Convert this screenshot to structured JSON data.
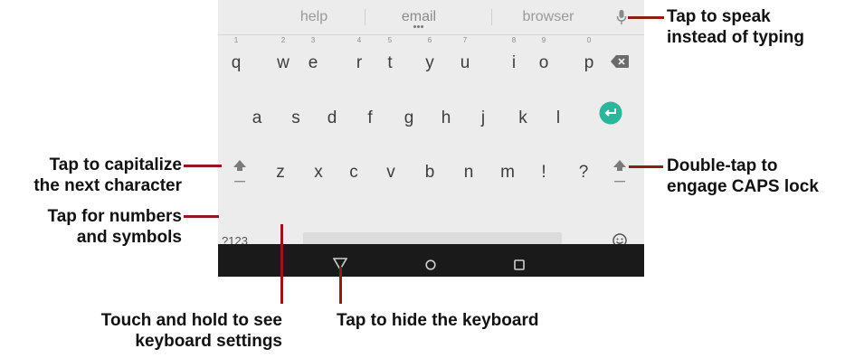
{
  "suggestions": {
    "left": "help",
    "center": "email",
    "right": "browser"
  },
  "icons": {
    "mic": "microphone-icon",
    "backspace": "backspace-icon",
    "enter": "enter-icon",
    "shift": "shift-arrow-icon",
    "emoji": "emoji-icon",
    "back": "nav-back-triangle-icon",
    "home": "nav-home-circle-icon",
    "recents": "nav-recents-square-icon"
  },
  "keys": {
    "row1": [
      {
        "letter": "q",
        "number": "1"
      },
      {
        "letter": "w",
        "number": "2"
      },
      {
        "letter": "e",
        "number": "3"
      },
      {
        "letter": "r",
        "number": "4"
      },
      {
        "letter": "t",
        "number": "5"
      },
      {
        "letter": "y",
        "number": "6"
      },
      {
        "letter": "u",
        "number": "7"
      },
      {
        "letter": "i",
        "number": "8"
      },
      {
        "letter": "o",
        "number": "9"
      },
      {
        "letter": "p",
        "number": "0"
      }
    ],
    "row2": [
      "a",
      "s",
      "d",
      "f",
      "g",
      "h",
      "j",
      "k",
      "l"
    ],
    "row3": [
      "z",
      "x",
      "c",
      "v",
      "b",
      "n",
      "m",
      "!",
      "?"
    ],
    "row4": {
      "numbers_key": "?123",
      "comma_key": ",",
      "period_key": "."
    }
  },
  "colors": {
    "accent": "#2bb59a",
    "callout_line": "#8e1a1a",
    "navbar": "#1a1a1a"
  },
  "callouts": {
    "speak": [
      "Tap to speak",
      "instead of typing"
    ],
    "capitalize": [
      "Tap to capitalize",
      "the next character"
    ],
    "numbers": [
      "Tap for numbers",
      "and symbols"
    ],
    "caps_lock": [
      "Double-tap to",
      "engage CAPS lock"
    ],
    "settings": [
      "Touch and hold to see",
      "keyboard settings"
    ],
    "hide": [
      "Tap to hide the keyboard"
    ]
  }
}
